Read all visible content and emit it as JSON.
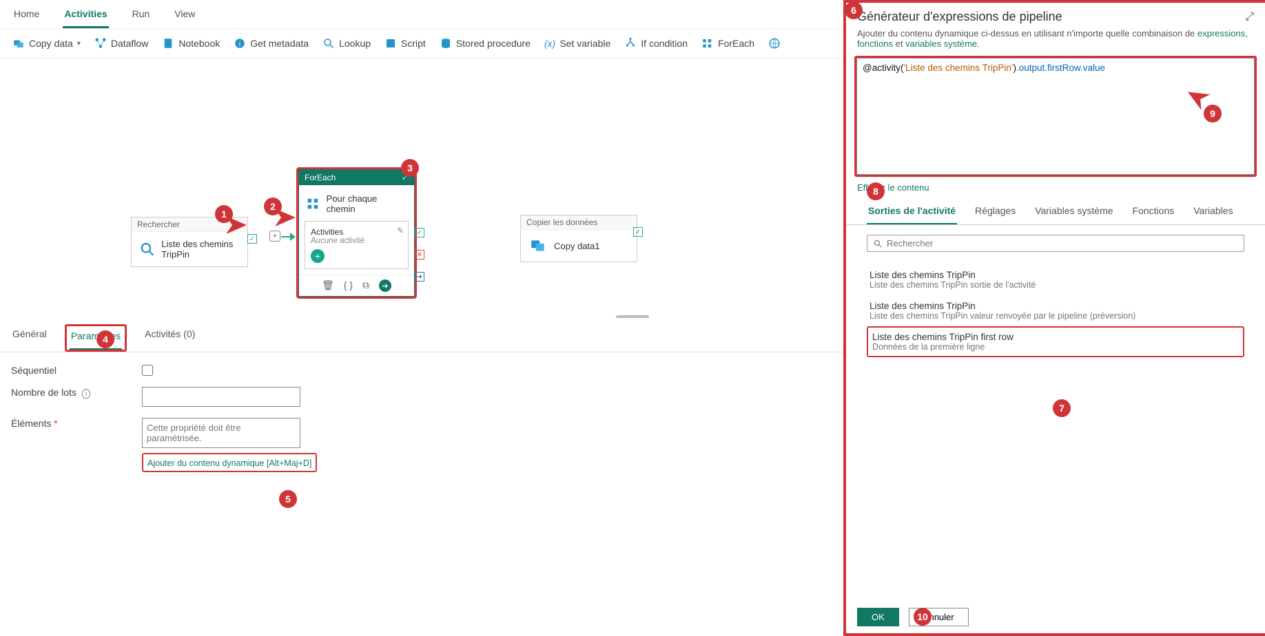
{
  "topTabs": {
    "home": "Home",
    "activities": "Activities",
    "run": "Run",
    "view": "View"
  },
  "toolbar": {
    "copy": "Copy data",
    "dataflow": "Dataflow",
    "notebook": "Notebook",
    "metadata": "Get metadata",
    "lookup": "Lookup",
    "script": "Script",
    "sproc": "Stored procedure",
    "setvar": "Set variable",
    "if": "If condition",
    "foreach": "ForEach"
  },
  "canvas": {
    "lookup": {
      "header": "Rechercher",
      "title": "Liste des chemins TripPin"
    },
    "foreach": {
      "header": "ForEach",
      "title": "Pour chaque chemin",
      "actHeader": "Activities",
      "actSub": "Aucune activité"
    },
    "copy": {
      "header": "Copier les données",
      "title": "Copy data1"
    }
  },
  "propTabs": {
    "general": "Général",
    "params": "Paramètres",
    "acts": "Activités (0)"
  },
  "props": {
    "seq": "Séquentiel",
    "batch": "Nombre de lots",
    "items": "Éléments",
    "itemsPlaceholder": "Cette propriété doit être paramétrisée.",
    "dynLink": "Ajouter du contenu dynamique [Alt+Maj+D]"
  },
  "panel": {
    "title": "Générateur d'expressions de pipeline",
    "desc1": "Ajouter du contenu dynamique ci-dessus en utilisant n'importe quelle combinaison de ",
    "exprLink": "expressions",
    "descComma": ", ",
    "fnLink": "fonctions",
    "descEt": " et ",
    "sysLink": "variables système",
    "descDot": ".",
    "expression_raw": "@activity('Liste des chemins TripPin').output.firstRow.value",
    "clear": "Effacer le contenu",
    "tabs": {
      "out": "Sorties de l'activité",
      "set": "Réglages",
      "sys": "Variables système",
      "fn": "Fonctions",
      "var": "Variables"
    },
    "searchPlaceholder": "Rechercher",
    "items": [
      {
        "t": "Liste des chemins TripPin",
        "d": "Liste des chemins TripPin sortie de l'activité"
      },
      {
        "t": "Liste des chemins TripPin",
        "d": "Liste des chemins TripPin valeur renvoyée par le pipeline (préversion)"
      },
      {
        "t": "Liste des chemins TripPin first row",
        "d": "Données de la première ligne"
      }
    ],
    "ok": "OK",
    "cancel": "Annuler"
  },
  "callouts": {
    "c1": "1",
    "c2": "2",
    "c3": "3",
    "c4": "4",
    "c5": "5",
    "c6": "6",
    "c7": "7",
    "c8": "8",
    "c9": "9",
    "c10": "10"
  }
}
